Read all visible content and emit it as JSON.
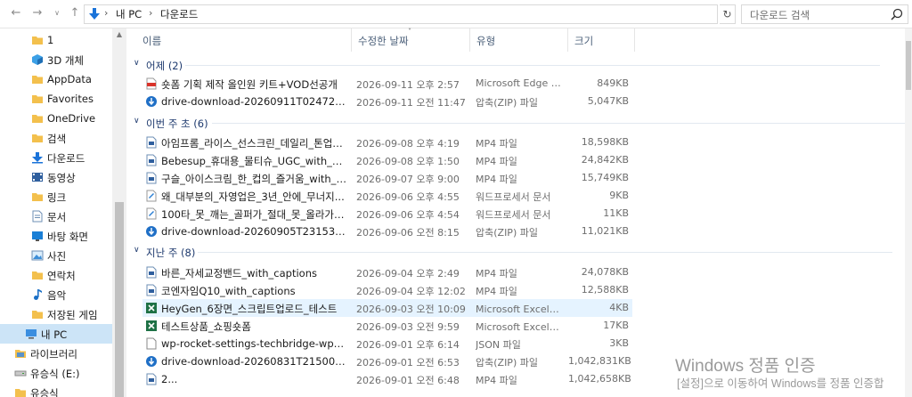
{
  "colors": {
    "accent": "#1e3a6e",
    "selected": "#cce4f7",
    "hover_row": "#e5f3ff",
    "header_text": "#4c607a"
  },
  "address": {
    "crumbs": [
      "내 PC",
      "다운로드"
    ],
    "search_placeholder": "다운로드 검색"
  },
  "sidebar": {
    "items": [
      {
        "label": "1",
        "icon": "folder-pinned-icon"
      },
      {
        "label": "3D 개체",
        "icon": "3d-objects-icon"
      },
      {
        "label": "AppData",
        "icon": "folder-pinned-icon"
      },
      {
        "label": "Favorites",
        "icon": "folder-pinned-icon"
      },
      {
        "label": "OneDrive",
        "icon": "folder-pinned-icon"
      },
      {
        "label": "검색",
        "icon": "folder-pinned-icon"
      },
      {
        "label": "다운로드",
        "icon": "download-icon"
      },
      {
        "label": "동영상",
        "icon": "videos-icon"
      },
      {
        "label": "링크",
        "icon": "folder-pinned-icon"
      },
      {
        "label": "문서",
        "icon": "documents-icon"
      },
      {
        "label": "바탕 화면",
        "icon": "desktop-icon"
      },
      {
        "label": "사진",
        "icon": "pictures-icon"
      },
      {
        "label": "연락처",
        "icon": "folder-pinned-icon"
      },
      {
        "label": "음악",
        "icon": "music-icon"
      },
      {
        "label": "저장된 게임",
        "icon": "folder-pinned-icon"
      },
      {
        "label": "내 PC",
        "icon": "pc-icon"
      },
      {
        "label": "라이브러리",
        "icon": "library-icon"
      },
      {
        "label": "유승식 (E:)",
        "icon": "drive-icon"
      },
      {
        "label": "유승식",
        "icon": "folder-icon"
      }
    ]
  },
  "columns": {
    "name": "이름",
    "date": "수정한 날짜",
    "type": "유형",
    "size": "크기"
  },
  "groups": [
    {
      "label": "어제 (2)"
    },
    {
      "label": "이번 주 초 (6)"
    },
    {
      "label": "지난 주 (8)"
    }
  ],
  "files": [
    {
      "name": "숏폼 기획 제작 올인원 키트+VOD선공개",
      "date": "2026-09-11 오후 2:57",
      "type": "Microsoft Edge P...",
      "size": "849KB",
      "icon": "pdf-icon"
    },
    {
      "name": "drive-download-20260911T024729Z-1-0...",
      "date": "2026-09-11 오전 11:47",
      "type": "압축(ZIP) 파일",
      "size": "5,047KB",
      "icon": "zip-icon"
    },
    {
      "name": "아임프롬_라이스_선스크린_데일리_톤업_...",
      "date": "2026-09-08 오후 4:19",
      "type": "MP4 파일",
      "size": "18,598KB",
      "icon": "video-file-icon"
    },
    {
      "name": "Bebesup_휴대용_물티슈_UGC_with_capti...",
      "date": "2026-09-08 오후 1:50",
      "type": "MP4 파일",
      "size": "24,842KB",
      "icon": "video-file-icon"
    },
    {
      "name": "구슬_아이스크림_한_컵의_즐거움_with_c...",
      "date": "2026-09-07 오후 9:00",
      "type": "MP4 파일",
      "size": "15,749KB",
      "icon": "video-file-icon"
    },
    {
      "name": "왜_대부분의_자영업은_3년_안에_무너지...",
      "date": "2026-09-06 오후 4:55",
      "type": "워드프로세서 문서",
      "size": "9KB",
      "icon": "hwp-icon"
    },
    {
      "name": "100타_못_깨는_골퍼가_절대_못_올라가는...",
      "date": "2026-09-06 오후 4:54",
      "type": "워드프로세서 문서",
      "size": "11KB",
      "icon": "hwp-icon"
    },
    {
      "name": "drive-download-20260905T231530Z-1-0...",
      "date": "2026-09-06 오전 8:15",
      "type": "압축(ZIP) 파일",
      "size": "11,021KB",
      "icon": "zip-icon"
    },
    {
      "name": "바른_자세교정밴드_with_captions",
      "date": "2026-09-04 오후 2:49",
      "type": "MP4 파일",
      "size": "24,078KB",
      "icon": "video-file-icon"
    },
    {
      "name": "코엔자임Q10_with_captions",
      "date": "2026-09-04 오후 12:02",
      "type": "MP4 파일",
      "size": "12,588KB",
      "icon": "video-file-icon"
    },
    {
      "name": "HeyGen_6장면_스크립트업로드_테스트",
      "date": "2026-09-03 오전 10:09",
      "type": "Microsoft Excel 워...",
      "size": "4KB",
      "icon": "excel-icon"
    },
    {
      "name": "테스트상품_쇼핑숏폼",
      "date": "2026-09-03 오전 9:59",
      "type": "Microsoft Excel 워...",
      "size": "17KB",
      "icon": "excel-icon"
    },
    {
      "name": "wp-rocket-settings-techbridge-wp.com-...",
      "date": "2026-09-01 오후 6:14",
      "type": "JSON 파일",
      "size": "3KB",
      "icon": "json-file-icon"
    },
    {
      "name": "drive-download-20260831T215006Z-1-0...",
      "date": "2026-09-01 오전 6:53",
      "type": "압축(ZIP) 파일",
      "size": "1,042,831KB",
      "icon": "zip-icon"
    },
    {
      "name": "2...",
      "date": "2026-09-01 오전 6:48",
      "type": "MP4 파일",
      "size": "1,042,658KB",
      "icon": "video-file-icon"
    }
  ],
  "watermark": {
    "title": "Windows 정품 인증",
    "subtitle": "[설정]으로 이동하여 Windows를 정품 인증합"
  }
}
